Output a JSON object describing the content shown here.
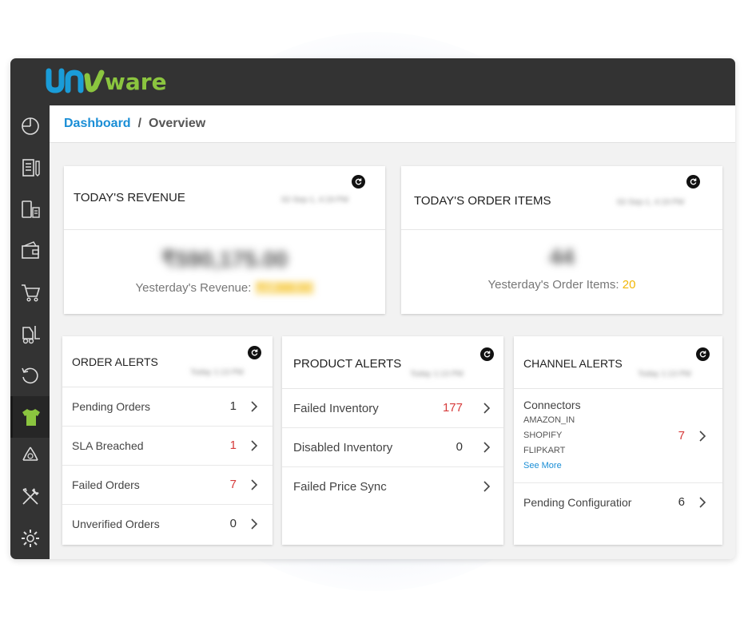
{
  "app": {
    "brand": "unware"
  },
  "breadcrumb": {
    "root": "Dashboard",
    "separator": "/",
    "current": "Overview"
  },
  "sidebar": {
    "items": [
      {
        "name": "dashboard-icon"
      },
      {
        "name": "documents-icon"
      },
      {
        "name": "mobile-catalog-icon"
      },
      {
        "name": "wallet-icon"
      },
      {
        "name": "cart-icon"
      },
      {
        "name": "forklift-icon"
      },
      {
        "name": "returns-icon"
      },
      {
        "name": "tshirt-icon",
        "active": true
      },
      {
        "name": "recycle-icon"
      },
      {
        "name": "tools-icon"
      },
      {
        "name": "settings-icon"
      }
    ],
    "active_color": "#8bc53f"
  },
  "revenue": {
    "title": "TODAY'S REVENUE",
    "timestamp": "02-Sep-1, 4:19 PM",
    "amount": "₹590,175.00",
    "yesterday_label": "Yesterday's Revenue: ",
    "yesterday_value": "₹7,388.00"
  },
  "order_items": {
    "title": "TODAY'S ORDER ITEMS",
    "timestamp": "02-Sep-1, 4:19 PM",
    "count": "44",
    "yesterday_label": "Yesterday's Order Items: ",
    "yesterday_value": "20"
  },
  "order_alerts": {
    "title": "ORDER ALERTS",
    "timestamp": "Today 1:13 PM",
    "rows": [
      {
        "label": "Pending Orders",
        "count": "1",
        "color": "dark"
      },
      {
        "label": "SLA Breached",
        "count": "1",
        "color": "red"
      },
      {
        "label": "Failed Orders",
        "count": "7",
        "color": "red"
      },
      {
        "label": "Unverified Orders",
        "count": "0",
        "color": "dark"
      }
    ]
  },
  "product_alerts": {
    "title": "PRODUCT ALERTS",
    "timestamp": "Today 1:13 PM",
    "rows": [
      {
        "label": "Failed Inventory",
        "count": "177",
        "color": "red"
      },
      {
        "label": "Disabled Inventory",
        "count": "0",
        "color": "dark"
      },
      {
        "label": "Failed Price Sync",
        "count": "",
        "color": "dark"
      }
    ]
  },
  "channel_alerts": {
    "title": "CHANNEL ALERTS",
    "timestamp": "Today 1:13 PM",
    "connectors": {
      "label": "Connectors",
      "channels": [
        "AMAZON_IN",
        "SHOPIFY",
        "FLIPKART"
      ],
      "see_more": "See More",
      "count": "7"
    },
    "pending": {
      "label": "Pending Configuratior",
      "count": "6"
    }
  },
  "colors": {
    "accent_blue": "#1a8ed6",
    "alert_red": "#d63b3b",
    "highlight_yellow": "#f2b705",
    "dark_bar": "#333333"
  }
}
